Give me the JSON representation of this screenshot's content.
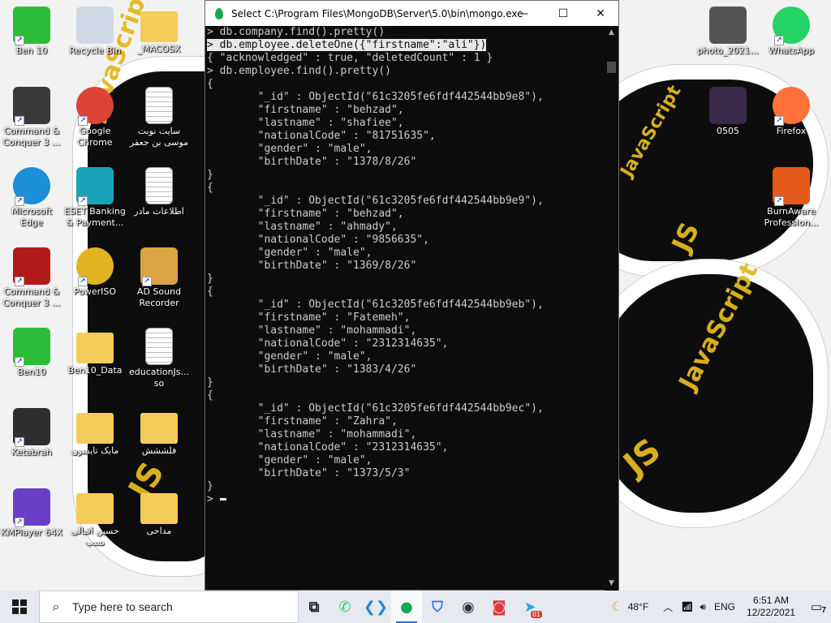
{
  "wallpaper": {
    "text": [
      "JavaScript",
      "JS",
      "JS",
      "JavaScript",
      "JS",
      "JS",
      "JavaScript",
      "JS"
    ]
  },
  "desktop_icons": [
    {
      "label": "Ben 10",
      "icon": "ben10-icon",
      "color": "#2bbd3a"
    },
    {
      "label": "Recycle Bin",
      "icon": "recycle-bin-icon",
      "color": "#cfd9e6"
    },
    {
      "label": "_MACOSX",
      "icon": "folder-icon",
      "color": "#f3cc5a"
    },
    {
      "label": "photo_2021...",
      "icon": "photo-file-icon",
      "color": "#555555"
    },
    {
      "label": "WhatsApp",
      "icon": "whatsapp-icon",
      "color": "#25d366"
    },
    {
      "label": "Command & Conquer 3 ...",
      "icon": "command-conquer-icon",
      "color": "#3a3a3a"
    },
    {
      "label": "Google Chrome",
      "icon": "chrome-icon",
      "color": "#db4437"
    },
    {
      "label": "سایت نوبت موسی بن جعفر",
      "icon": "text-file-icon",
      "color": "#ffffff"
    },
    {
      "label": "0505",
      "icon": "video-file-icon",
      "color": "#3a2a4a"
    },
    {
      "label": "Firefox",
      "icon": "firefox-icon",
      "color": "#ff7139"
    },
    {
      "label": "Microsoft Edge",
      "icon": "edge-icon",
      "color": "#1b8fd8"
    },
    {
      "label": "ESET Banking & Payment...",
      "icon": "eset-icon",
      "color": "#1aa3b8"
    },
    {
      "label": "اطلاعات مادر",
      "icon": "text-file-icon",
      "color": "#ffffff"
    },
    {
      "label": "BurnAware Profession...",
      "icon": "burnaware-icon",
      "color": "#e45b1a"
    },
    {
      "label": "Command & Conquer 3 ...",
      "icon": "command-conquer-icon",
      "color": "#b01a1a"
    },
    {
      "label": "PowerISO",
      "icon": "poweriso-icon",
      "color": "#e0b320"
    },
    {
      "label": "AD Sound Recorder",
      "icon": "speaker-icon",
      "color": "#d9a441"
    },
    {
      "label": "Ben10",
      "icon": "ben10-icon",
      "color": "#2bbd3a"
    },
    {
      "label": "Ben10_Data",
      "icon": "folder-icon",
      "color": "#f3cc5a"
    },
    {
      "label": "educationJs... so",
      "icon": "text-file-icon",
      "color": "#ffffff"
    },
    {
      "label": "Ketabrah",
      "icon": "ketabrah-icon",
      "color": "#2f2f2f"
    },
    {
      "label": "مایک تایسون",
      "icon": "folder-icon",
      "color": "#f3cc5a"
    },
    {
      "label": "فلششش",
      "icon": "folder-icon",
      "color": "#f3cc5a"
    },
    {
      "label": "KMPlayer 64X",
      "icon": "kmplayer-icon",
      "color": "#6a3fc6"
    },
    {
      "label": "حسین اقبالی نسب",
      "icon": "folder-icon",
      "color": "#f3cc5a"
    },
    {
      "label": "مداحی",
      "icon": "folder-icon",
      "color": "#f3cc5a"
    }
  ],
  "console": {
    "title": "Select C:\\Program Files\\MongoDB\\Server\\5.0\\bin\\mongo.exe",
    "minimize": "—",
    "maximize": "☐",
    "close": "✕",
    "lines": [
      "> db.company.find().pretty()",
      "> db.employee.deleteOne({\"firstname\":\"ali\"})",
      "{ \"acknowledged\" : true, \"deletedCount\" : 1 }",
      "> db.employee.find().pretty()",
      "{",
      "        \"_id\" : ObjectId(\"61c3205fe6fdf442544bb9e8\"),",
      "        \"firstname\" : \"behzad\",",
      "        \"lastname\" : \"shafiee\",",
      "        \"nationalCode\" : \"81751635\",",
      "        \"gender\" : \"male\",",
      "        \"birthDate\" : \"1378/8/26\"",
      "}",
      "{",
      "        \"_id\" : ObjectId(\"61c3205fe6fdf442544bb9e9\"),",
      "        \"firstname\" : \"behzad\",",
      "        \"lastname\" : \"ahmady\",",
      "        \"nationalCode\" : \"9856635\",",
      "        \"gender\" : \"male\",",
      "        \"birthDate\" : \"1369/8/26\"",
      "}",
      "{",
      "        \"_id\" : ObjectId(\"61c3205fe6fdf442544bb9eb\"),",
      "        \"firstname\" : \"Fatemeh\",",
      "        \"lastname\" : \"mohammadi\",",
      "        \"nationalCode\" : \"2312314635\",",
      "        \"gender\" : \"male\",",
      "        \"birthDate\" : \"1383/4/26\"",
      "}",
      "{",
      "        \"_id\" : ObjectId(\"61c3205fe6fdf442544bb9ec\"),",
      "        \"firstname\" : \"Zahra\",",
      "        \"lastname\" : \"mohammadi\",",
      "        \"nationalCode\" : \"2312314635\",",
      "        \"gender\" : \"male\",",
      "        \"birthDate\" : \"1373/5/3\"",
      "}",
      ">"
    ],
    "highlighted_line": 1
  },
  "taskbar": {
    "search_placeholder": "Type here to search",
    "apps": [
      {
        "name": "task-view-icon",
        "glyph": "⧉",
        "color": "#222222"
      },
      {
        "name": "whatsapp-icon",
        "glyph": "✆",
        "color": "#25d366"
      },
      {
        "name": "vscode-icon",
        "glyph": "❮❯",
        "color": "#1f8ad2"
      },
      {
        "name": "mongodb-icon",
        "glyph": "●",
        "color": "#13aa52",
        "active": true
      },
      {
        "name": "brave-icon",
        "glyph": "⛉",
        "color": "#2f6fdc"
      },
      {
        "name": "obs-icon",
        "glyph": "◉",
        "color": "#333333"
      },
      {
        "name": "screen-recorder-icon",
        "glyph": "◙",
        "color": "#d93a3a"
      },
      {
        "name": "telegram-icon",
        "glyph": "➤",
        "color": "#2aa3e0",
        "badge": "01"
      }
    ],
    "weather": "48°F",
    "language": "ENG",
    "time": "6:51 AM",
    "date": "12/22/2021",
    "notification_count": "7"
  }
}
